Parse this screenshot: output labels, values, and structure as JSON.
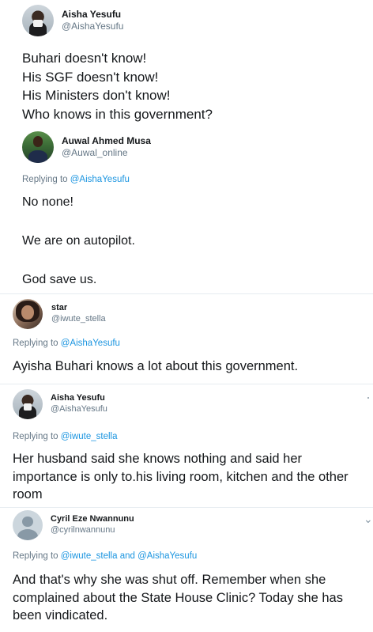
{
  "tweets": [
    {
      "display_name": "Aisha Yesufu",
      "handle": "@AishaYesufu",
      "body": "Buhari doesn't know!\nHis SGF doesn't know!\nHis Ministers don't know!\nWho knows in this government?"
    },
    {
      "display_name": "Auwal Ahmed Musa",
      "handle": "@Auwal_online",
      "replying_prefix": "Replying to",
      "replying_to": "@AishaYesufu",
      "body": "No none!\n\nWe are on autopilot.\n\nGod save us."
    },
    {
      "display_name": "star",
      "handle": "@iwute_stella",
      "replying_prefix": "Replying to",
      "replying_to": "@AishaYesufu",
      "body": "Ayisha Buhari knows a lot about this government."
    },
    {
      "display_name": "Aisha Yesufu",
      "handle": "@AishaYesufu",
      "replying_prefix": "Replying to",
      "replying_to": "@iwute_stella",
      "body": "Her husband said she knows nothing and said her importance is only to.his living room, kitchen and the other room"
    },
    {
      "display_name": "Cyril Eze Nwannunu",
      "handle": "@cyrilnwannunu",
      "replying_prefix": "Replying to",
      "replying_to": "@iwute_stella",
      "replying_and": "and",
      "replying_to_2": "@AishaYesufu",
      "body": "And that's why she was shut off. Remember when she complained about the State House Clinic? Today she has been vindicated."
    }
  ],
  "icons": {
    "more_menu": "chevron-down-icon"
  },
  "colors": {
    "link": "#1b95e0",
    "secondary_text": "#657786",
    "primary_text": "#14171a",
    "divider": "#e6ecf0"
  }
}
